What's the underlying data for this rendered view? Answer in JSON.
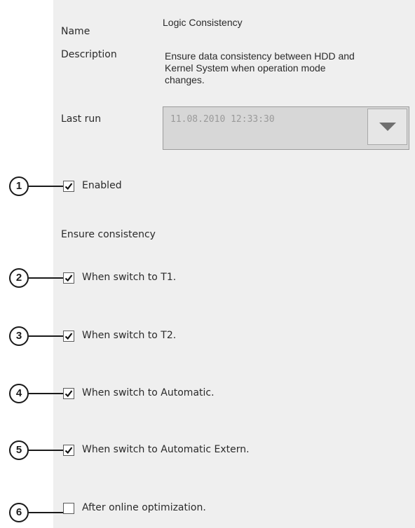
{
  "form": {
    "name_label": "Name",
    "name_value": "Logic Consistency",
    "description_label": "Description",
    "description_value": "Ensure data consistency between HDD and\nKernel System when operation mode\nchanges.",
    "last_run_label": "Last run",
    "last_run_value": "11.08.2010 12:33:30",
    "enabled": {
      "label": "Enabled",
      "checked": true
    },
    "section_label": "Ensure consistency",
    "options": [
      {
        "label": "When switch to T1.",
        "checked": true
      },
      {
        "label": "When switch to T2.",
        "checked": true
      },
      {
        "label": "When switch to Automatic.",
        "checked": true
      },
      {
        "label": "When switch to Automatic Extern.",
        "checked": true
      },
      {
        "label": "After online optimization.",
        "checked": false
      }
    ]
  },
  "callouts": [
    "1",
    "2",
    "3",
    "4",
    "5",
    "6"
  ],
  "colors": {
    "panel_background": "#efefef",
    "disabled_field": "#d7d7d7",
    "disabled_text": "#9a9a9a",
    "callout_ink": "#1a1a1a"
  },
  "icons": {
    "dropdown": "chevron-down-icon",
    "checkmark": "check-icon"
  }
}
